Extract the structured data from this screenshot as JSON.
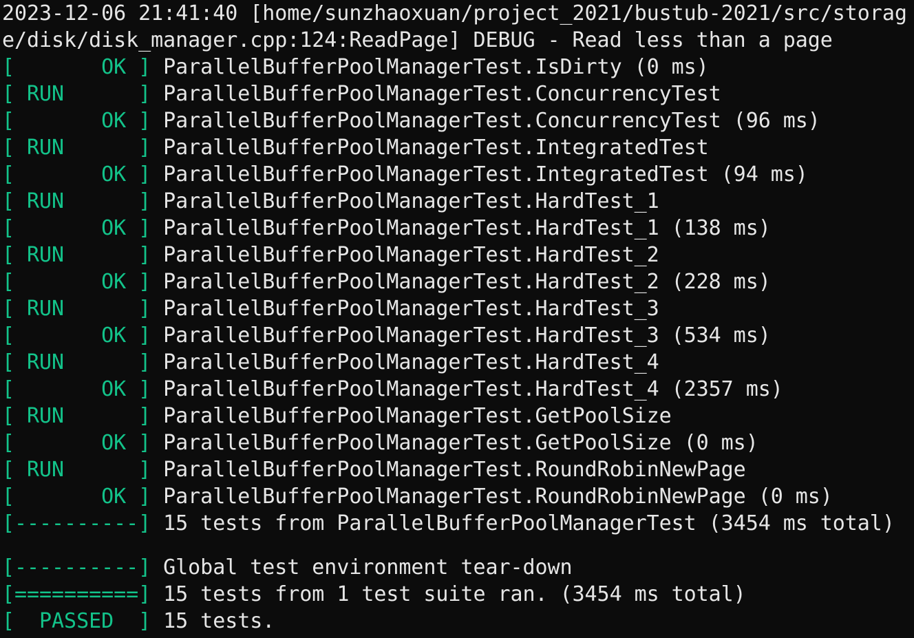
{
  "terminal": {
    "header_lines": [
      "2023-12-06 21:41:40 [home/sunzhaoxuan/project_2021/bustub-2021/src/storag",
      "e/disk/disk_manager.cpp:124:ReadPage] DEBUG - Read less than a page"
    ],
    "lines": [
      {
        "tag": "[       OK ]",
        "text": " ParallelBufferPoolManagerTest.IsDirty (0 ms)"
      },
      {
        "tag": "[ RUN      ]",
        "text": " ParallelBufferPoolManagerTest.ConcurrencyTest"
      },
      {
        "tag": "[       OK ]",
        "text": " ParallelBufferPoolManagerTest.ConcurrencyTest (96 ms)"
      },
      {
        "tag": "[ RUN      ]",
        "text": " ParallelBufferPoolManagerTest.IntegratedTest"
      },
      {
        "tag": "[       OK ]",
        "text": " ParallelBufferPoolManagerTest.IntegratedTest (94 ms)"
      },
      {
        "tag": "[ RUN      ]",
        "text": " ParallelBufferPoolManagerTest.HardTest_1"
      },
      {
        "tag": "[       OK ]",
        "text": " ParallelBufferPoolManagerTest.HardTest_1 (138 ms)"
      },
      {
        "tag": "[ RUN      ]",
        "text": " ParallelBufferPoolManagerTest.HardTest_2"
      },
      {
        "tag": "[       OK ]",
        "text": " ParallelBufferPoolManagerTest.HardTest_2 (228 ms)"
      },
      {
        "tag": "[ RUN      ]",
        "text": " ParallelBufferPoolManagerTest.HardTest_3"
      },
      {
        "tag": "[       OK ]",
        "text": " ParallelBufferPoolManagerTest.HardTest_3 (534 ms)"
      },
      {
        "tag": "[ RUN      ]",
        "text": " ParallelBufferPoolManagerTest.HardTest_4"
      },
      {
        "tag": "[       OK ]",
        "text": " ParallelBufferPoolManagerTest.HardTest_4 (2357 ms)"
      },
      {
        "tag": "[ RUN      ]",
        "text": " ParallelBufferPoolManagerTest.GetPoolSize"
      },
      {
        "tag": "[       OK ]",
        "text": " ParallelBufferPoolManagerTest.GetPoolSize (0 ms)"
      },
      {
        "tag": "[ RUN      ]",
        "text": " ParallelBufferPoolManagerTest.RoundRobinNewPage"
      },
      {
        "tag": "[       OK ]",
        "text": " ParallelBufferPoolManagerTest.RoundRobinNewPage (0 ms)"
      },
      {
        "tag": "[----------]",
        "text": " 15 tests from ParallelBufferPoolManagerTest (3454 ms total)"
      }
    ],
    "footer_lines": [
      {
        "tag": "[----------]",
        "text": " Global test environment tear-down"
      },
      {
        "tag": "[==========]",
        "text": " 15 tests from 1 test suite ran. (3454 ms total)"
      },
      {
        "tag": "[  PASSED  ]",
        "text": " 15 tests."
      }
    ],
    "colors": {
      "background": "#0c0c0c",
      "text": "#e6e6e6",
      "status_tag": "#13c38a"
    }
  }
}
